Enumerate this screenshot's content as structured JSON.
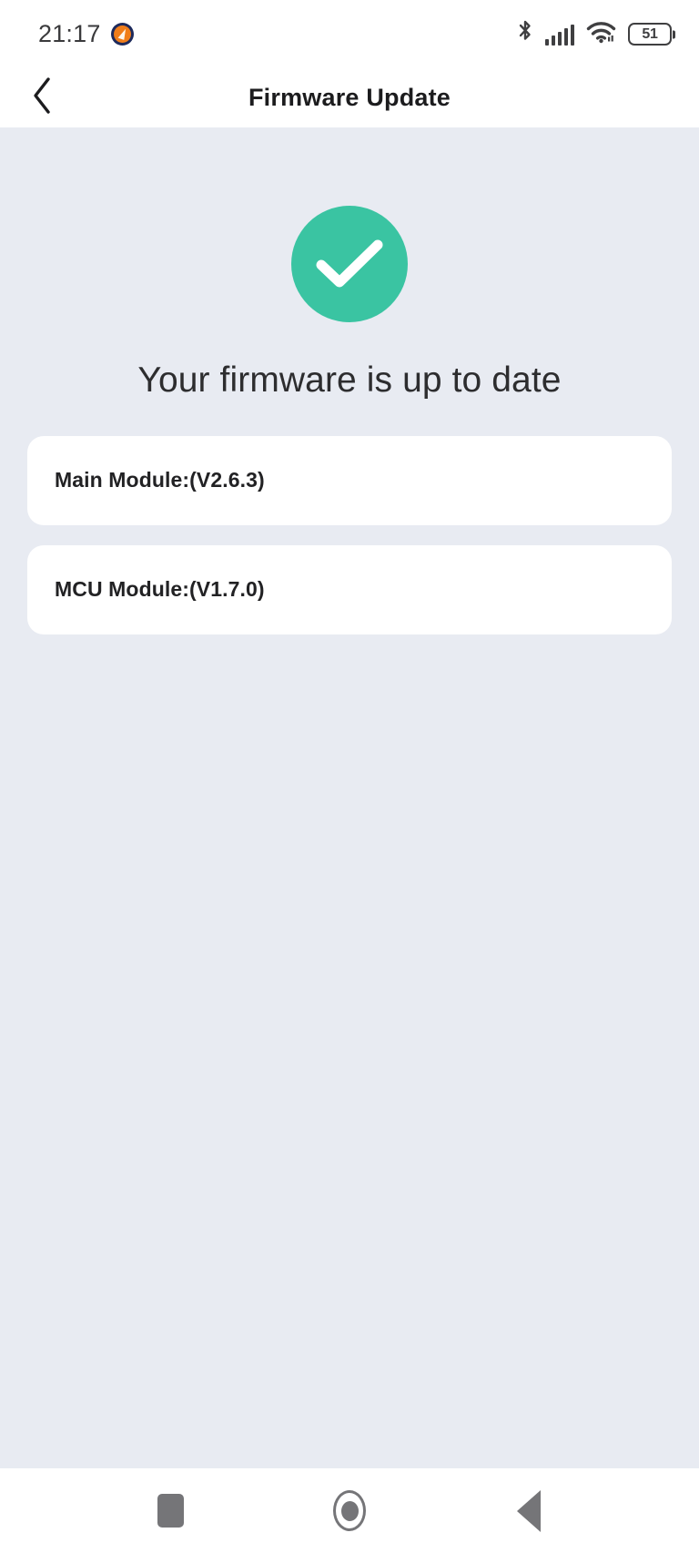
{
  "status_bar": {
    "time": "21:17",
    "app_icon": "flame-app-icon",
    "bluetooth_icon": "bluetooth-icon",
    "cellular_icon": "cellular-signal-icon",
    "wifi_icon": "wifi-icon",
    "battery_level": "51"
  },
  "header": {
    "back_icon": "chevron-left-icon",
    "title": "Firmware Update"
  },
  "main": {
    "status_icon": "check-circle-icon",
    "status_color": "#3ac4a2",
    "heading": "Your firmware is up to date",
    "modules": [
      {
        "label": "Main Module:(V2.6.3)"
      },
      {
        "label": "MCU Module:(V1.7.0)"
      }
    ]
  },
  "nav_bar": {
    "recents_icon": "square-recents-icon",
    "home_icon": "circle-home-icon",
    "back_icon": "triangle-back-icon"
  },
  "colors": {
    "background": "#e8ebf2",
    "card": "#ffffff",
    "accent_green": "#3ac4a2",
    "text_primary": "#222224"
  }
}
